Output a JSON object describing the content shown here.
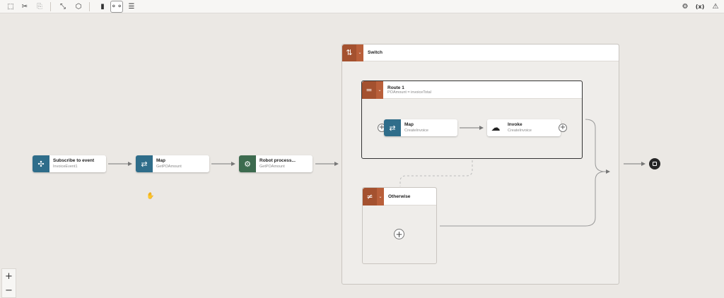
{
  "toolbar": {
    "left_icons": [
      "select-icon",
      "cut-icon",
      "paste-icon",
      "collapse-icon",
      "package-icon",
      "vertical-layout-icon",
      "horizontal-layout-icon",
      "outline-layout-icon"
    ],
    "right_icons": [
      "settings-icon",
      "variables-icon",
      "warning-icon"
    ],
    "variables_label": "(x)"
  },
  "nodes": {
    "subscribe": {
      "title": "Subscribe to event",
      "subtitle": "InvoiceEvent1",
      "color": "#2f6d8a"
    },
    "map1": {
      "title": "Map",
      "subtitle": "GetPOAmount",
      "color": "#2f6d8a"
    },
    "robot": {
      "title": "Robot process...",
      "subtitle": "GetPOAmount",
      "color": "#3d6b4f"
    },
    "map2": {
      "title": "Map",
      "subtitle": "CreateInvoice",
      "color": "#2f6d8a"
    },
    "invoke": {
      "title": "Invoke",
      "subtitle": "CreateInvoice"
    }
  },
  "switch": {
    "label": "Switch",
    "color": "#a4512f"
  },
  "route1": {
    "label": "Route 1",
    "condition": "POAmount = invoiceTotal"
  },
  "otherwise": {
    "label": "Otherwise"
  },
  "zoom": {
    "in_label": "+",
    "out_label": "−"
  }
}
